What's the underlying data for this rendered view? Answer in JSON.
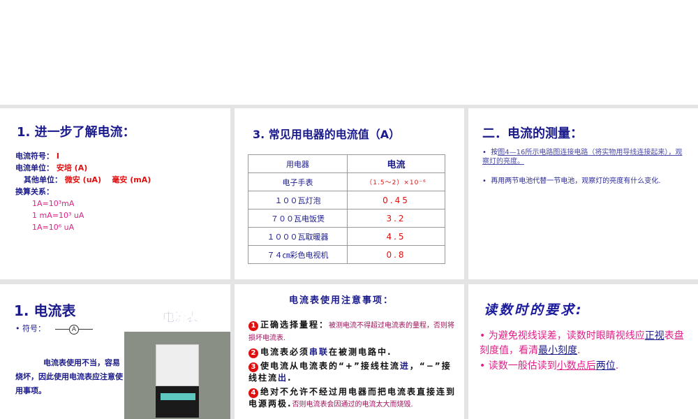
{
  "slide1": {
    "title": "1. 进一步了解电流：",
    "symbol_label": "电流符号：",
    "symbol": "I",
    "unit_label": "电流单位：",
    "unit": "安培 (A)",
    "other_label": "其他单位：",
    "other1": "微安 (uA)",
    "other2": "毫安 (mA)",
    "conv_label": "换算关系：",
    "conv": [
      "1A=10³mA",
      "1 mA=10³ uA",
      "1A=10⁶ uA"
    ]
  },
  "slide2": {
    "title": "3. 常见用电器的电流值（A）",
    "headers": [
      "用电器",
      "电流"
    ],
    "rows": [
      [
        "电子手表",
        "（1.5～2）×10⁻⁶"
      ],
      [
        "１００瓦灯泡",
        "0.45"
      ],
      [
        "７００瓦电饭煲",
        "3.2"
      ],
      [
        "１０００瓦取暖器",
        "4.5"
      ],
      [
        "７４㎝彩色电视机",
        "0.8"
      ]
    ]
  },
  "slide3": {
    "title": "二．电流的测量：",
    "b1_pre": "按",
    "b1_link": "图4—16所示电路图连接电路（将实物用导线连接起来），观察灯的亮度。",
    "b2": "再用两节电池代替一节电池，观察灯的亮度有什么变化."
  },
  "slide4": {
    "title": "1. 电流表",
    "symbol_label": "符号：",
    "symbol": "A",
    "image_title": "电流表",
    "body": "电流表使用不当，容易烧坏，因此使用电流表应注意使用事项。"
  },
  "slide5": {
    "title": "电流表使用注意事项：",
    "items": [
      {
        "n": "1",
        "text": "正确选择量程：",
        "note": "被测电流不得超过电流表的量程，否则将损坏电流表."
      },
      {
        "n": "2",
        "pre": "电流表必须",
        "hl": "串联",
        "post": "在被测电路中."
      },
      {
        "n": "3",
        "pre": "使电流从电流表的“+”接线柱流",
        "hl": "进",
        "mid": "，“−”接线柱流",
        "hl2": "出",
        "post": "."
      },
      {
        "n": "4",
        "text": "绝对不允许不经过用电器而把电流表直接连到电源两极.",
        "note": "否则电流表会因通过的电流太大而烧毁."
      }
    ]
  },
  "slide6": {
    "title": "读数时的要求:",
    "b1_a": "为避免视线误差，读数时眼睛视线应",
    "b1_u1": "正视",
    "b1_b": "表盘刻度值，看清",
    "b1_u2": "最小刻度",
    "b1_c": ".",
    "b2_a": "读数一般估读到",
    "b2_u1": "小数点后",
    "b2_u2": "两位",
    "b2_c": "."
  }
}
